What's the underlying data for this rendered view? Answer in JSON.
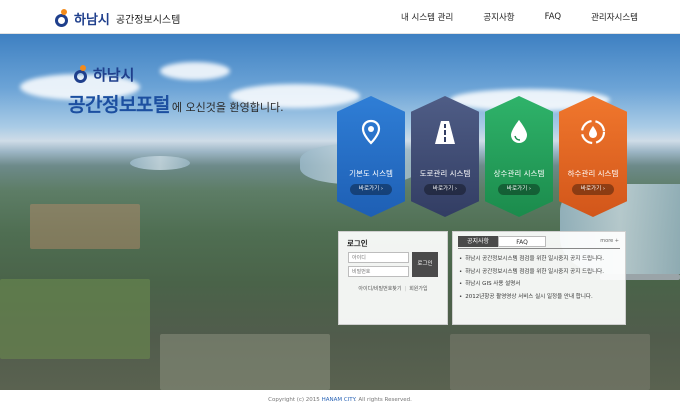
{
  "header": {
    "logo_city": "하남시",
    "logo_title": "공간정보시스템",
    "nav": [
      "내 시스템 관리",
      "공지사항",
      "FAQ",
      "관리자시스템"
    ]
  },
  "hero": {
    "logo_city": "하남시",
    "title_main": "공간정보포털",
    "title_sub": "에 오신것을 환영합니다."
  },
  "tiles": [
    {
      "label": "기본도 시스템",
      "button": "바로가기 ›",
      "icon": "map-pin-icon",
      "color": "#1e5fb4"
    },
    {
      "label": "도로관리 시스템",
      "button": "바로가기 ›",
      "icon": "road-icon",
      "color": "#323d63"
    },
    {
      "label": "상수관리 시스템",
      "button": "바로가기 ›",
      "icon": "water-drop-icon",
      "color": "#1b8b4c"
    },
    {
      "label": "하수관리 시스템",
      "button": "바로가기 ›",
      "icon": "recycle-drop-icon",
      "color": "#d2561a"
    }
  ],
  "login": {
    "title": "로그인",
    "id_placeholder": "아이디",
    "pw_placeholder": "비밀번호",
    "button": "로그인",
    "find_link": "아이디/비밀번호찾기",
    "join_link": "회원가입"
  },
  "notice": {
    "tab_active": "공지사항",
    "tab_inactive": "FAQ",
    "more": "more +",
    "items": [
      "하남시 공간정보시스템 점검을 위한 일시중지 공지 드립니다.",
      "하남시 공간정보시스템 점검을 위한 일시중지 공지 드립니다.",
      "하남시 GIS 사용 설명서",
      "2012년항공 촬영영상 서비스 실시 일정을 안내 합니다."
    ]
  },
  "footer": {
    "prefix": "Copyright (c) 2015 ",
    "city": "HANAM CITY",
    "suffix": ". All rights Reserved."
  }
}
